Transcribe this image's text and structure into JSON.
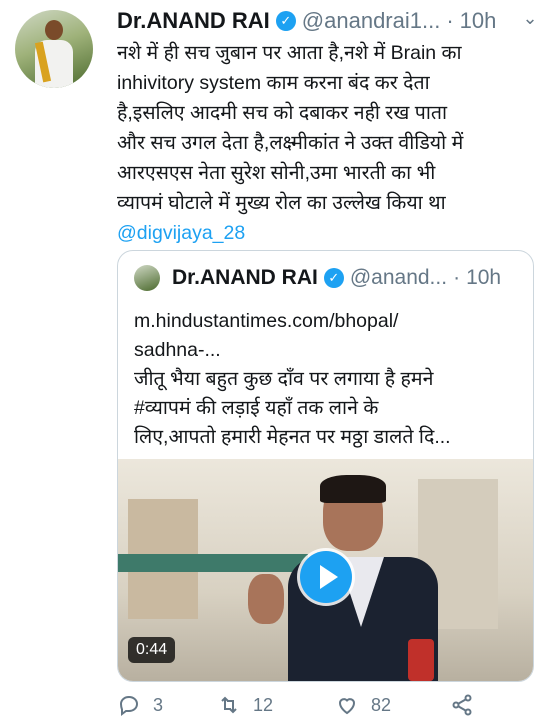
{
  "tweet": {
    "author_name": "Dr.ANAND RAI",
    "handle": "@anandrai1...",
    "separator": "·",
    "time": "10h",
    "text_lines": [
      "नशे में ही सच जुबान पर आता है,नशे में Brain का",
      "inhivitory system काम करना बंद कर देता",
      "है,इसलिए आदमी सच को दबाकर नही रख पाता",
      "और सच उगल देता है,लक्ष्मीकांत ने उक्त वीडियो में",
      "आरएसएस नेता सुरेश सोनी,उमा भारती का भी",
      "व्यापमं घोटाले में मुख्य रोल का उल्लेख किया था"
    ],
    "mention": "@digvijaya_28"
  },
  "quoted": {
    "author_name": "Dr.ANAND RAI",
    "handle": "@anand...",
    "separator": "·",
    "time": "10h",
    "text_lines": [
      "m.hindustantimes.com/bhopal/",
      "sadhna-...",
      "जीतू भैया बहुत कुछ दाँव पर लगाया है हमने",
      "#व्यापमं की लड़ाई यहाँ तक लाने के",
      "लिए,आपतो हमारी मेहनत पर मठ्ठा डालते दि..."
    ],
    "video_duration": "0:44"
  },
  "actions": {
    "reply_count": "3",
    "retweet_count": "12",
    "like_count": "82"
  },
  "icons": {
    "verified": "verified-badge-icon",
    "caret": "chevron-down-icon",
    "reply": "reply-icon",
    "retweet": "retweet-icon",
    "like": "heart-icon",
    "share": "share-icon"
  },
  "colors": {
    "accent": "#1da1f2",
    "muted": "#657786",
    "text": "#14171a"
  }
}
